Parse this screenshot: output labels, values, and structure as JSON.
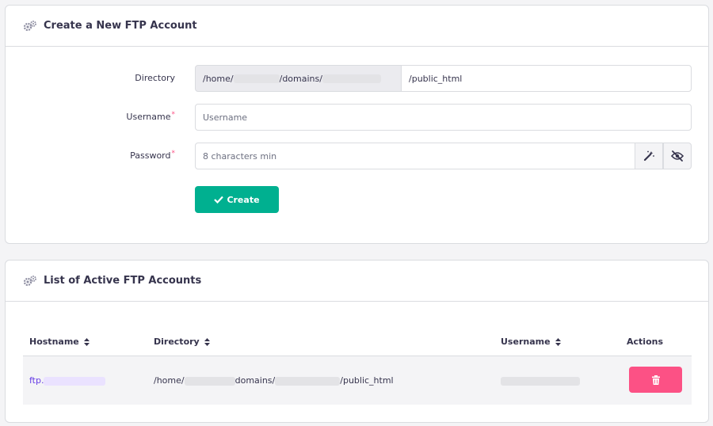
{
  "create_card": {
    "title": "Create a New FTP Account",
    "directory_label": "Directory",
    "directory_prefix_start": "/home/",
    "directory_prefix_mid": "/domains/",
    "directory_value": "/public_html",
    "username_label": "Username",
    "username_placeholder": "Username",
    "password_label": "Password",
    "password_placeholder": "8 characters min",
    "required_mark": "*",
    "create_button": "Create"
  },
  "list_card": {
    "title": "List of Active FTP Accounts",
    "columns": [
      "Hostname",
      "Directory",
      "Username",
      "Actions"
    ],
    "rows": [
      {
        "hostname": "ftp.",
        "directory_start": "/home/",
        "directory_mid": "domains/",
        "directory_end": "/public_html"
      }
    ]
  },
  "icons": {
    "header": "gears-icon",
    "generate": "magic-wand-icon",
    "visibility": "eye-slash-icon",
    "create": "check-icon",
    "delete": "trash-icon",
    "sort": "sort-icon"
  },
  "colors": {
    "accent_green": "#00b090",
    "danger_pink": "#fc5185",
    "link_purple": "#673de6",
    "text_dark": "#36344d"
  }
}
